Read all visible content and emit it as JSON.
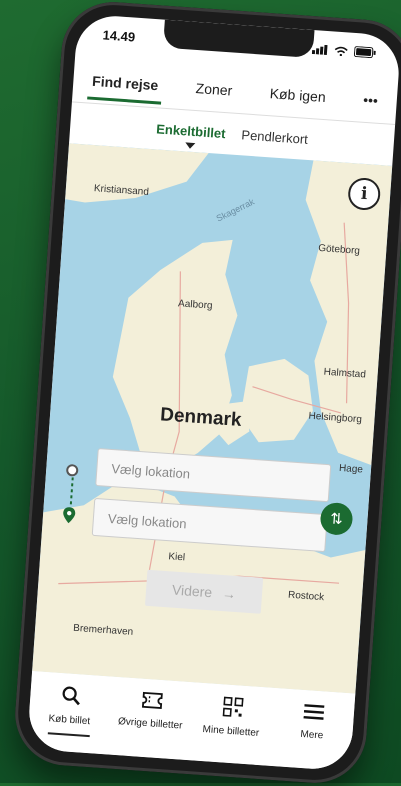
{
  "status": {
    "time": "14.49"
  },
  "top_tabs": [
    {
      "label": "Find rejse",
      "active": true
    },
    {
      "label": "Zoner",
      "active": false
    },
    {
      "label": "Køb igen",
      "active": false
    },
    {
      "label": "•••",
      "active": false
    }
  ],
  "sub_tabs": [
    {
      "label": "Enkeltbillet",
      "active": true
    },
    {
      "label": "Pendlerkort",
      "active": false
    }
  ],
  "map": {
    "country": "Denmark",
    "places": [
      "Kristiansand",
      "Skagerrak",
      "Göteborg",
      "Aalborg",
      "Halmstad",
      "Helsingborg",
      "Hage",
      "Kiel",
      "Rostock",
      "Bremerhaven"
    ],
    "info_label": "i"
  },
  "form": {
    "from_placeholder": "Vælg lokation",
    "to_placeholder": "Vælg lokation",
    "swap_icon": "⇅",
    "next_label": "Videre",
    "next_arrow": "→"
  },
  "bottom_nav": [
    {
      "label": "Køb billet",
      "icon": "search-icon",
      "active": true
    },
    {
      "label": "Øvrige billetter",
      "icon": "ticket-icon",
      "active": false
    },
    {
      "label": "Mine billetter",
      "icon": "qr-icon",
      "active": false
    },
    {
      "label": "Mere",
      "icon": "menu-icon",
      "active": false
    }
  ],
  "colors": {
    "accent": "#1b6b31",
    "background": "#1a6a30",
    "water": "#a7d3e6",
    "land": "#f3efd9"
  }
}
